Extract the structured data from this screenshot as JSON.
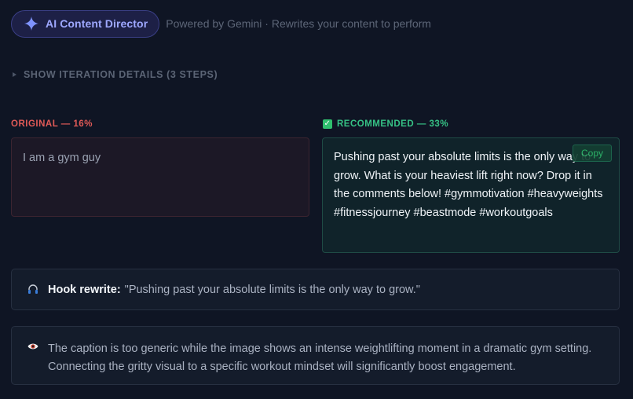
{
  "header": {
    "badge_label": "AI Content Director",
    "badge_icon": "sparkle-icon",
    "subtitle": "Powered by Gemini · Rewrites your content to perform"
  },
  "iterations": {
    "toggle_label": "SHOW ITERATION DETAILS (3 STEPS)"
  },
  "original": {
    "label": "ORIGINAL — 16%",
    "text": "I am a gym guy"
  },
  "recommended": {
    "label": "RECOMMENDED — 33%",
    "text": "Pushing past your absolute limits is the only way to grow. What is your heaviest lift right now? Drop it in the comments below! #gymmotivation #heavyweights #fitnessjourney #beastmode #workoutgoals",
    "copy_label": "Copy"
  },
  "hook": {
    "icon": "headphones-icon",
    "label": "Hook rewrite:",
    "text": "\"Pushing past your absolute limits is the only way to grow.\""
  },
  "insight": {
    "icon": "eye-icon",
    "text": "The caption is too generic while the image shows an intense weightlifting moment in a dramatic gym setting. Connecting the gritty visual to a specific workout mindset will significantly boost engagement."
  },
  "colors": {
    "background": "#0f1524",
    "accent": "#9ea8ff",
    "original_label": "#e05a57",
    "recommended_label": "#36c285"
  }
}
